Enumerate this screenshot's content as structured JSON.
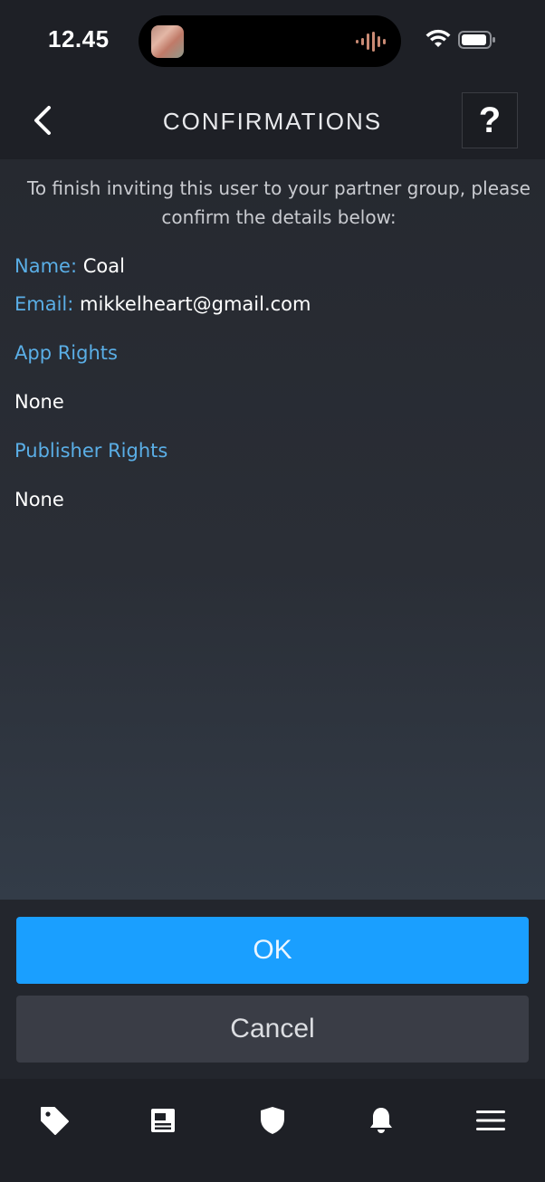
{
  "status_bar": {
    "time": "12.45",
    "icons": [
      "now-playing-artwork",
      "audio-waveform-icon",
      "wifi-icon",
      "battery-icon"
    ]
  },
  "nav": {
    "title": "CONFIRMATIONS",
    "back_icon": "chevron-left-icon",
    "help_label": "?"
  },
  "content": {
    "intro": "To finish inviting this user to your partner group, please confirm the details below:",
    "name_label": "Name:",
    "name_value": "Coal",
    "email_label": "Email:",
    "email_value": "mikkelheart@gmail.com",
    "app_rights_heading": "App Rights",
    "app_rights_value": "None",
    "publisher_rights_heading": "Publisher Rights",
    "publisher_rights_value": "None"
  },
  "actions": {
    "ok_label": "OK",
    "cancel_label": "Cancel"
  },
  "tab_bar": {
    "tabs": [
      {
        "icon": "tag-icon"
      },
      {
        "icon": "news-icon"
      },
      {
        "icon": "shield-icon"
      },
      {
        "icon": "bell-icon"
      },
      {
        "icon": "menu-icon"
      }
    ]
  },
  "colors": {
    "accent": "#1a9fff",
    "label": "#5aaee6",
    "background": "#24272e",
    "bar": "#1e2026"
  }
}
